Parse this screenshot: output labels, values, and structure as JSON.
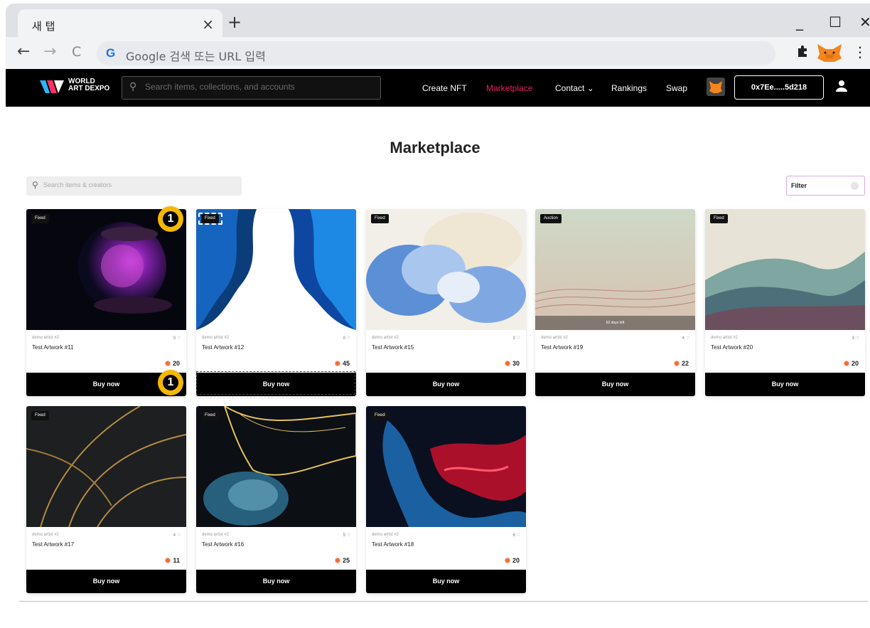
{
  "browser": {
    "tab_title": "새 탭",
    "tab_close": "×",
    "new_tab": "+",
    "omnibox_placeholder": "Google 검색 또는 URL 입력",
    "back": "←",
    "forward": "→",
    "reload": "C",
    "minimize": "_",
    "maximize": "☐",
    "close": "✕",
    "menu": "⋮",
    "g_letter": "G"
  },
  "header": {
    "logo_line1": "WORLD",
    "logo_line2": "ART DEXPO",
    "search_placeholder": "Search items, collections, and accounts",
    "nav": {
      "create": "Create NFT",
      "marketplace": "Marketplace",
      "contact": "Contact ⌄",
      "rankings": "Rankings",
      "swap": "Swap"
    },
    "wallet": "0x7Ee.....5d218",
    "active_color": "#e0245e"
  },
  "page": {
    "title": "Marketplace",
    "search_placeholder": "Search items & creators",
    "filter_label": "Filter"
  },
  "cards": [
    {
      "badge": "Fixed",
      "artist": "demo artist #2",
      "likes": "0 ♡",
      "title": "Test Artwork #11",
      "price": "20",
      "button": "Buy now"
    },
    {
      "badge": "Fixed",
      "artist": "demo artist #2",
      "likes": "0 ♡",
      "title": "Test Artwork #12",
      "price": "45",
      "button": "Buy now"
    },
    {
      "badge": "Fixed",
      "artist": "demo artist #2",
      "likes": "0 ♡",
      "title": "Test Artwork #15",
      "price": "30",
      "button": "Buy now"
    },
    {
      "badge": "Auction",
      "artist": "demo artist #2",
      "likes": "4 ♡",
      "title": "Test Artwork #19",
      "price": "22",
      "button": "Buy now",
      "timer": "62 days left"
    },
    {
      "badge": "Fixed",
      "artist": "demo artist #2",
      "likes": "3 ♡",
      "title": "Test Artwork #20",
      "price": "20",
      "button": "Buy now"
    },
    {
      "badge": "Fixed",
      "artist": "demo artist #2",
      "likes": "4 ♡",
      "title": "Test Artwork #17",
      "price": "11",
      "button": "Buy now"
    },
    {
      "badge": "Fixed",
      "artist": "demo artist #2",
      "likes": "5 ♡",
      "title": "Test Artwork #16",
      "price": "25",
      "button": "Buy now"
    },
    {
      "badge": "Fixed",
      "artist": "demo artist #2",
      "likes": "6 ♡",
      "title": "Test Artwork #18",
      "price": "20",
      "button": "Buy now"
    }
  ],
  "markers": [
    "1",
    "1"
  ]
}
